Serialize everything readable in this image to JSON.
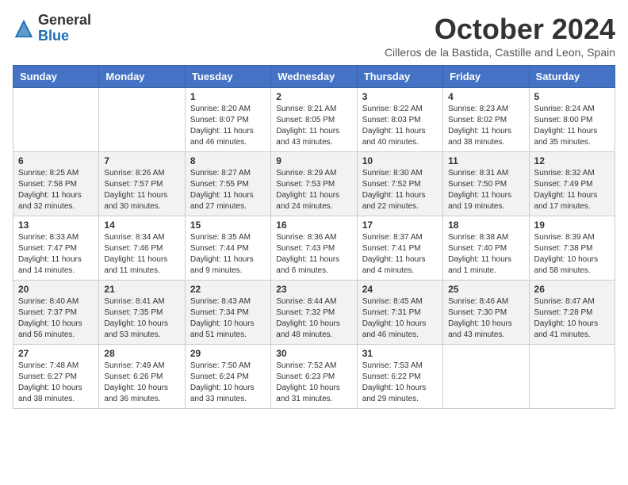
{
  "header": {
    "logo": {
      "general": "General",
      "blue": "Blue"
    },
    "title": "October 2024",
    "subtitle": "Cilleros de la Bastida, Castille and Leon, Spain"
  },
  "weekdays": [
    "Sunday",
    "Monday",
    "Tuesday",
    "Wednesday",
    "Thursday",
    "Friday",
    "Saturday"
  ],
  "weeks": [
    [
      {
        "day": "",
        "info": ""
      },
      {
        "day": "",
        "info": ""
      },
      {
        "day": "1",
        "info": "Sunrise: 8:20 AM\nSunset: 8:07 PM\nDaylight: 11 hours and 46 minutes."
      },
      {
        "day": "2",
        "info": "Sunrise: 8:21 AM\nSunset: 8:05 PM\nDaylight: 11 hours and 43 minutes."
      },
      {
        "day": "3",
        "info": "Sunrise: 8:22 AM\nSunset: 8:03 PM\nDaylight: 11 hours and 40 minutes."
      },
      {
        "day": "4",
        "info": "Sunrise: 8:23 AM\nSunset: 8:02 PM\nDaylight: 11 hours and 38 minutes."
      },
      {
        "day": "5",
        "info": "Sunrise: 8:24 AM\nSunset: 8:00 PM\nDaylight: 11 hours and 35 minutes."
      }
    ],
    [
      {
        "day": "6",
        "info": "Sunrise: 8:25 AM\nSunset: 7:58 PM\nDaylight: 11 hours and 32 minutes."
      },
      {
        "day": "7",
        "info": "Sunrise: 8:26 AM\nSunset: 7:57 PM\nDaylight: 11 hours and 30 minutes."
      },
      {
        "day": "8",
        "info": "Sunrise: 8:27 AM\nSunset: 7:55 PM\nDaylight: 11 hours and 27 minutes."
      },
      {
        "day": "9",
        "info": "Sunrise: 8:29 AM\nSunset: 7:53 PM\nDaylight: 11 hours and 24 minutes."
      },
      {
        "day": "10",
        "info": "Sunrise: 8:30 AM\nSunset: 7:52 PM\nDaylight: 11 hours and 22 minutes."
      },
      {
        "day": "11",
        "info": "Sunrise: 8:31 AM\nSunset: 7:50 PM\nDaylight: 11 hours and 19 minutes."
      },
      {
        "day": "12",
        "info": "Sunrise: 8:32 AM\nSunset: 7:49 PM\nDaylight: 11 hours and 17 minutes."
      }
    ],
    [
      {
        "day": "13",
        "info": "Sunrise: 8:33 AM\nSunset: 7:47 PM\nDaylight: 11 hours and 14 minutes."
      },
      {
        "day": "14",
        "info": "Sunrise: 8:34 AM\nSunset: 7:46 PM\nDaylight: 11 hours and 11 minutes."
      },
      {
        "day": "15",
        "info": "Sunrise: 8:35 AM\nSunset: 7:44 PM\nDaylight: 11 hours and 9 minutes."
      },
      {
        "day": "16",
        "info": "Sunrise: 8:36 AM\nSunset: 7:43 PM\nDaylight: 11 hours and 6 minutes."
      },
      {
        "day": "17",
        "info": "Sunrise: 8:37 AM\nSunset: 7:41 PM\nDaylight: 11 hours and 4 minutes."
      },
      {
        "day": "18",
        "info": "Sunrise: 8:38 AM\nSunset: 7:40 PM\nDaylight: 11 hours and 1 minute."
      },
      {
        "day": "19",
        "info": "Sunrise: 8:39 AM\nSunset: 7:38 PM\nDaylight: 10 hours and 58 minutes."
      }
    ],
    [
      {
        "day": "20",
        "info": "Sunrise: 8:40 AM\nSunset: 7:37 PM\nDaylight: 10 hours and 56 minutes."
      },
      {
        "day": "21",
        "info": "Sunrise: 8:41 AM\nSunset: 7:35 PM\nDaylight: 10 hours and 53 minutes."
      },
      {
        "day": "22",
        "info": "Sunrise: 8:43 AM\nSunset: 7:34 PM\nDaylight: 10 hours and 51 minutes."
      },
      {
        "day": "23",
        "info": "Sunrise: 8:44 AM\nSunset: 7:32 PM\nDaylight: 10 hours and 48 minutes."
      },
      {
        "day": "24",
        "info": "Sunrise: 8:45 AM\nSunset: 7:31 PM\nDaylight: 10 hours and 46 minutes."
      },
      {
        "day": "25",
        "info": "Sunrise: 8:46 AM\nSunset: 7:30 PM\nDaylight: 10 hours and 43 minutes."
      },
      {
        "day": "26",
        "info": "Sunrise: 8:47 AM\nSunset: 7:28 PM\nDaylight: 10 hours and 41 minutes."
      }
    ],
    [
      {
        "day": "27",
        "info": "Sunrise: 7:48 AM\nSunset: 6:27 PM\nDaylight: 10 hours and 38 minutes."
      },
      {
        "day": "28",
        "info": "Sunrise: 7:49 AM\nSunset: 6:26 PM\nDaylight: 10 hours and 36 minutes."
      },
      {
        "day": "29",
        "info": "Sunrise: 7:50 AM\nSunset: 6:24 PM\nDaylight: 10 hours and 33 minutes."
      },
      {
        "day": "30",
        "info": "Sunrise: 7:52 AM\nSunset: 6:23 PM\nDaylight: 10 hours and 31 minutes."
      },
      {
        "day": "31",
        "info": "Sunrise: 7:53 AM\nSunset: 6:22 PM\nDaylight: 10 hours and 29 minutes."
      },
      {
        "day": "",
        "info": ""
      },
      {
        "day": "",
        "info": ""
      }
    ]
  ]
}
